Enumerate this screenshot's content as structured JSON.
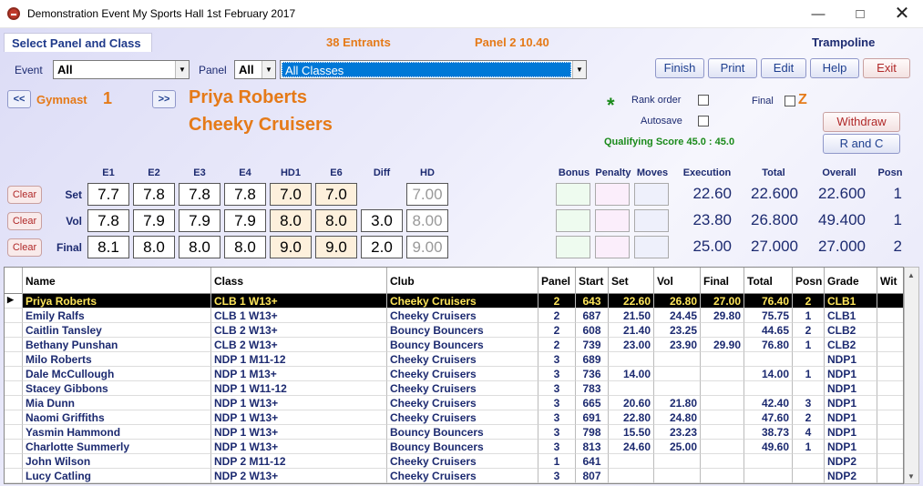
{
  "window": {
    "title": "Demonstration Event   My Sports Hall   1st February 2017"
  },
  "header": {
    "tab": "Select Panel and Class",
    "entrants": "38 Entrants",
    "panel_time": "Panel 2  10.40",
    "discipline": "Trampoline"
  },
  "filters": {
    "event_label": "Event",
    "event_value": "All",
    "panel_label": "Panel",
    "panel_value": "All",
    "class_value": "All Classes"
  },
  "buttons": {
    "finish": "Finish",
    "print": "Print",
    "edit": "Edit",
    "help": "Help",
    "exit": "Exit",
    "withdraw": "Withdraw",
    "r_and_c": "R and C"
  },
  "gymnast": {
    "prev": "<<",
    "next": ">>",
    "label": "Gymnast",
    "number": "1",
    "name": "Priya Roberts",
    "club": "Cheeky Cruisers"
  },
  "options": {
    "rank_order": "Rank order",
    "autosave": "Autosave",
    "final": "Final",
    "z": "Z",
    "qualifying": "Qualifying Score 45.0 : 45.0",
    "star": "*"
  },
  "score_headers": [
    "E1",
    "E2",
    "E3",
    "E4",
    "HD1",
    "E6",
    "Diff",
    "HD"
  ],
  "extra_headers": [
    "Bonus",
    "Penalty",
    "Moves"
  ],
  "result_headers": [
    "Execution",
    "Total",
    "Overall",
    "Posn"
  ],
  "routines": [
    {
      "label": "Set",
      "clear": "Clear",
      "scores": [
        "7.7",
        "7.8",
        "7.8",
        "7.8",
        "7.0",
        "7.0",
        "",
        "7.00"
      ],
      "execution": "22.60",
      "total": "22.600",
      "overall": "22.600",
      "posn": "1"
    },
    {
      "label": "Vol",
      "clear": "Clear",
      "scores": [
        "7.8",
        "7.9",
        "7.9",
        "7.9",
        "8.0",
        "8.0",
        "3.0",
        "8.00"
      ],
      "execution": "23.80",
      "total": "26.800",
      "overall": "49.400",
      "posn": "1"
    },
    {
      "label": "Final",
      "clear": "Clear",
      "scores": [
        "8.1",
        "8.0",
        "8.0",
        "8.0",
        "9.0",
        "9.0",
        "2.0",
        "9.00"
      ],
      "execution": "25.00",
      "total": "27.000",
      "overall": "27.000",
      "posn": "2"
    }
  ],
  "table": {
    "columns": [
      "Name",
      "Class",
      "Club",
      "Panel",
      "Start",
      "Set",
      "Vol",
      "Final",
      "Total",
      "Posn",
      "Grade",
      "Wit"
    ],
    "rows": [
      [
        "Priya Roberts",
        "CLB 1 W13+",
        "Cheeky Cruisers",
        "2",
        "643",
        "22.60",
        "26.80",
        "27.00",
        "76.40",
        "2",
        "CLB1"
      ],
      [
        "Emily Ralfs",
        "CLB 1 W13+",
        "Cheeky Cruisers",
        "2",
        "687",
        "21.50",
        "24.45",
        "29.80",
        "75.75",
        "1",
        "CLB1"
      ],
      [
        "Caitlin Tansley",
        "CLB 2 W13+",
        "Bouncy Bouncers",
        "2",
        "608",
        "21.40",
        "23.25",
        "",
        "44.65",
        "2",
        "CLB2"
      ],
      [
        "Bethany Punshan",
        "CLB 2 W13+",
        "Bouncy Bouncers",
        "2",
        "739",
        "23.00",
        "23.90",
        "29.90",
        "76.80",
        "1",
        "CLB2"
      ],
      [
        "Milo Roberts",
        "NDP 1 M11-12",
        "Cheeky Cruisers",
        "3",
        "689",
        "",
        "",
        "",
        "",
        "",
        "NDP1"
      ],
      [
        "Dale McCullough",
        "NDP 1 M13+",
        "Cheeky Cruisers",
        "3",
        "736",
        "14.00",
        "",
        "",
        "14.00",
        "1",
        "NDP1"
      ],
      [
        "Stacey Gibbons",
        "NDP 1 W11-12",
        "Cheeky Cruisers",
        "3",
        "783",
        "",
        "",
        "",
        "",
        "",
        "NDP1"
      ],
      [
        "Mia Dunn",
        "NDP 1 W13+",
        "Cheeky Cruisers",
        "3",
        "665",
        "20.60",
        "21.80",
        "",
        "42.40",
        "3",
        "NDP1"
      ],
      [
        "Naomi Griffiths",
        "NDP 1 W13+",
        "Cheeky Cruisers",
        "3",
        "691",
        "22.80",
        "24.80",
        "",
        "47.60",
        "2",
        "NDP1"
      ],
      [
        "Yasmin Hammond",
        "NDP 1 W13+",
        "Bouncy Bouncers",
        "3",
        "798",
        "15.50",
        "23.23",
        "",
        "38.73",
        "4",
        "NDP1"
      ],
      [
        "Charlotte Summerly",
        "NDP 1 W13+",
        "Bouncy Bouncers",
        "3",
        "813",
        "24.60",
        "25.00",
        "",
        "49.60",
        "1",
        "NDP1"
      ],
      [
        "John Wilson",
        "NDP 2 M11-12",
        "Cheeky Cruisers",
        "1",
        "641",
        "",
        "",
        "",
        "",
        "",
        "NDP2"
      ],
      [
        "Lucy Catling",
        "NDP 2 W13+",
        "Cheeky Cruisers",
        "3",
        "807",
        "",
        "",
        "",
        "",
        "",
        "NDP2"
      ]
    ]
  },
  "icons": {
    "app": "app-icon",
    "minimize": "minimize-icon",
    "maximize": "maximize-icon",
    "close": "close-icon",
    "dropdown": "chevron-down-icon",
    "row_pointer": "row-pointer-icon"
  },
  "colors": {
    "accent": "#e57a18",
    "navy": "#1c2a70",
    "selected_row": "#000000",
    "selected_text": "#ffe65a",
    "qualifying": "#1a8a1a"
  }
}
